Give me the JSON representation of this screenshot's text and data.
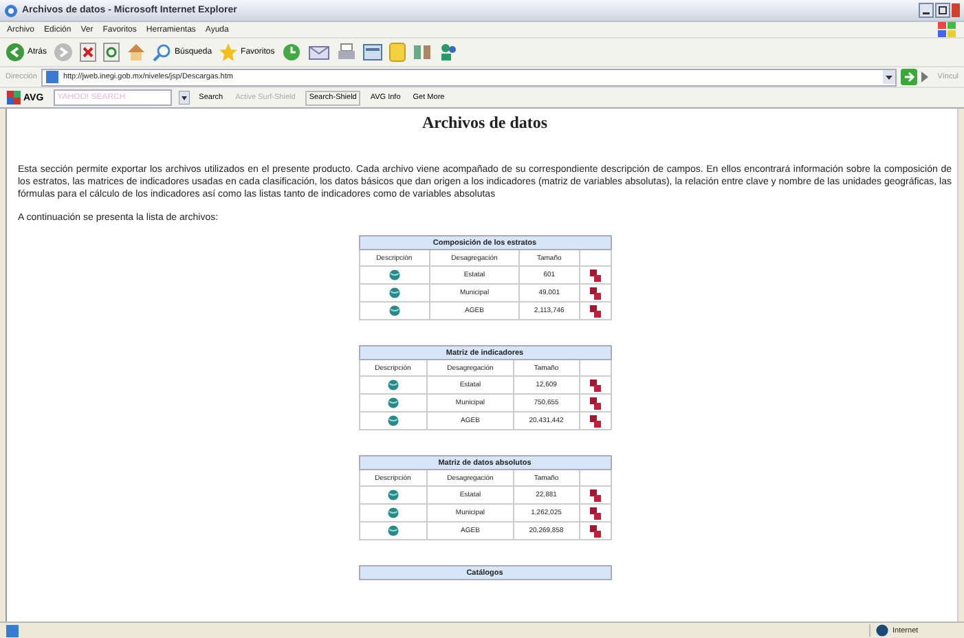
{
  "window": {
    "title": "Archivos de datos - Microsoft Internet Explorer"
  },
  "menu": [
    "Archivo",
    "Edición",
    "Ver",
    "Favoritos",
    "Herramientas",
    "Ayuda"
  ],
  "toolbar": {
    "back": "Atrás",
    "search": "Búsqueda",
    "favorites": "Favoritos"
  },
  "address": {
    "label": "Dirección",
    "value": "http://jweb.inegi.gob.mx/niveles/jsp/Descargas.htm",
    "links": "Víncul"
  },
  "avg_bar": {
    "brand": "AVG",
    "placeholder": "YAHOO! SEARCH",
    "search": "Search",
    "surf_shield": "Active Surf-Shield",
    "search_shield": "Search-Shield",
    "info": "AVG Info",
    "more": "Get More"
  },
  "page": {
    "heading": "Archivos de datos",
    "intro": "Esta sección permite exportar los archivos utilizados en el presente producto. Cada archivo viene acompañado de su correspondiente descripción de campos. En ellos encontrará información sobre la composición de los estratos, las matrices de indicadores usadas en cada clasificación, los datos básicos que dan origen a los indicadores (matriz de variables absolutas), la relación entre clave y nombre de las unidades geográficas, las fórmulas para el cálculo de los indicadores así como las listas tanto de indicadores como de variables absolutas",
    "list_intro": "A continuación se presenta la lista de archivos:",
    "tables": [
      {
        "title": "Composición de los estratos",
        "columns": [
          "Descripción",
          "Desagregación",
          "Tamaño"
        ],
        "rows": [
          {
            "level_name": "Estatal",
            "size": "601"
          },
          {
            "level_name": "Municipal",
            "size": "49,001"
          },
          {
            "level_name": "AGEB",
            "size": "2,113,746"
          }
        ]
      },
      {
        "title": "Matriz de indicadores",
        "columns": [
          "Descripción",
          "Desagregación",
          "Tamaño"
        ],
        "rows": [
          {
            "level_name": "Estatal",
            "size": "12,609"
          },
          {
            "level_name": "Municipal",
            "size": "750,655"
          },
          {
            "level_name": "AGEB",
            "size": "20,431,442"
          }
        ]
      },
      {
        "title": "Matriz de datos absolutos",
        "columns": [
          "Descripción",
          "Desagregación",
          "Tamaño"
        ],
        "rows": [
          {
            "level_name": "Estatal",
            "size": "22,881"
          },
          {
            "level_name": "Municipal",
            "size": "1,262,025"
          },
          {
            "level_name": "AGEB",
            "size": "20,269,858"
          }
        ]
      },
      {
        "title": "Catálogos"
      }
    ]
  },
  "status_bar": {
    "zone": "Internet"
  }
}
